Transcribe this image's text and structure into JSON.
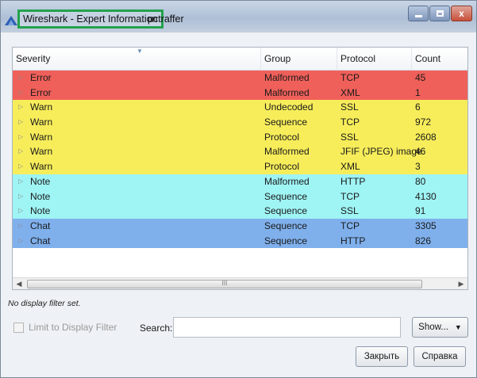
{
  "window": {
    "title": "Wireshark - Expert Information",
    "user": "pctraffer",
    "colors": {
      "title_highlight": "#23a24d"
    }
  },
  "table": {
    "headers": [
      "Severity",
      "Group",
      "Protocol",
      "Count"
    ],
    "rows": [
      {
        "severity": "Error",
        "group": "Malformed",
        "protocol": "TCP",
        "count": "45",
        "color": "#f0605a"
      },
      {
        "severity": "Error",
        "group": "Malformed",
        "protocol": "XML",
        "count": "1",
        "color": "#f0605a"
      },
      {
        "severity": "Warn",
        "group": "Undecoded",
        "protocol": "SSL",
        "count": "6",
        "color": "#f7ed5a"
      },
      {
        "severity": "Warn",
        "group": "Sequence",
        "protocol": "TCP",
        "count": "972",
        "color": "#f7ed5a"
      },
      {
        "severity": "Warn",
        "group": "Protocol",
        "protocol": "SSL",
        "count": "2608",
        "color": "#f7ed5a"
      },
      {
        "severity": "Warn",
        "group": "Malformed",
        "protocol": "JFIF (JPEG) image",
        "count": "46",
        "color": "#f7ed5a"
      },
      {
        "severity": "Warn",
        "group": "Protocol",
        "protocol": "XML",
        "count": "3",
        "color": "#f7ed5a"
      },
      {
        "severity": "Note",
        "group": "Malformed",
        "protocol": "HTTP",
        "count": "80",
        "color": "#9ff4f4"
      },
      {
        "severity": "Note",
        "group": "Sequence",
        "protocol": "TCP",
        "count": "4130",
        "color": "#9ff4f4"
      },
      {
        "severity": "Note",
        "group": "Sequence",
        "protocol": "SSL",
        "count": "91",
        "color": "#9ff4f4"
      },
      {
        "severity": "Chat",
        "group": "Sequence",
        "protocol": "TCP",
        "count": "3305",
        "color": "#7fb0ec"
      },
      {
        "severity": "Chat",
        "group": "Sequence",
        "protocol": "HTTP",
        "count": "826",
        "color": "#7fb0ec"
      }
    ]
  },
  "scrollbar": {
    "grip": "III"
  },
  "status": {
    "filter_note": "No display filter set."
  },
  "controls": {
    "limit_label": "Limit to Display Filter",
    "search_label": "Search:",
    "search_value": "",
    "show_label": "Show...",
    "close_label": "Закрыть",
    "help_label": "Справка"
  },
  "icons": {
    "app": "wireshark-fin-icon",
    "expand": "triangle-right-icon",
    "minimize": "minimize-icon",
    "maximize": "maximize-icon",
    "close": "close-icon"
  }
}
